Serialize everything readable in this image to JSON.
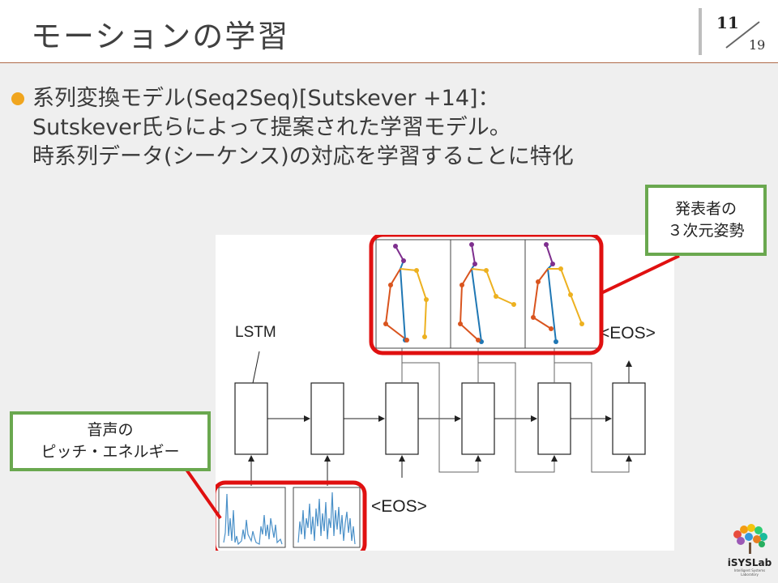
{
  "slide": {
    "title": "モーションの学習",
    "page_current": "11",
    "page_total": "19"
  },
  "bullet": {
    "line1": "系列変換モデル(Seq2Seq)[Sutskever +14]：",
    "line2": "Sutskever氏らによって提案された学習モデル。",
    "line3": "時系列データ(シーケンス)の対応を学習することに特化"
  },
  "figure": {
    "lstm_label": "LSTM",
    "eos_top": "<EOS>",
    "eos_bottom": "<EOS>",
    "cell_count": 6,
    "pose_frame_count": 3,
    "pitch_frame_count": 2
  },
  "callouts": {
    "pose": {
      "line1": "発表者の",
      "line2": "３次元姿勢"
    },
    "audio": {
      "line1": "音声の",
      "line2": "ピッチ・エネルギー"
    }
  },
  "logo": {
    "name": "iSYSLab",
    "subtitle": "Intelligent Systems Laboratory"
  },
  "colors": {
    "accent_bullet": "#f0a51e",
    "highlight_box": "#e01010",
    "callout_border": "#6aa84f",
    "header_rule": "#b06b4a",
    "limb_left": "#d9541e",
    "limb_right": "#edb120",
    "spine": "#1f77b4",
    "head": "#7e2f8e",
    "waveform": "#4a90c8"
  }
}
